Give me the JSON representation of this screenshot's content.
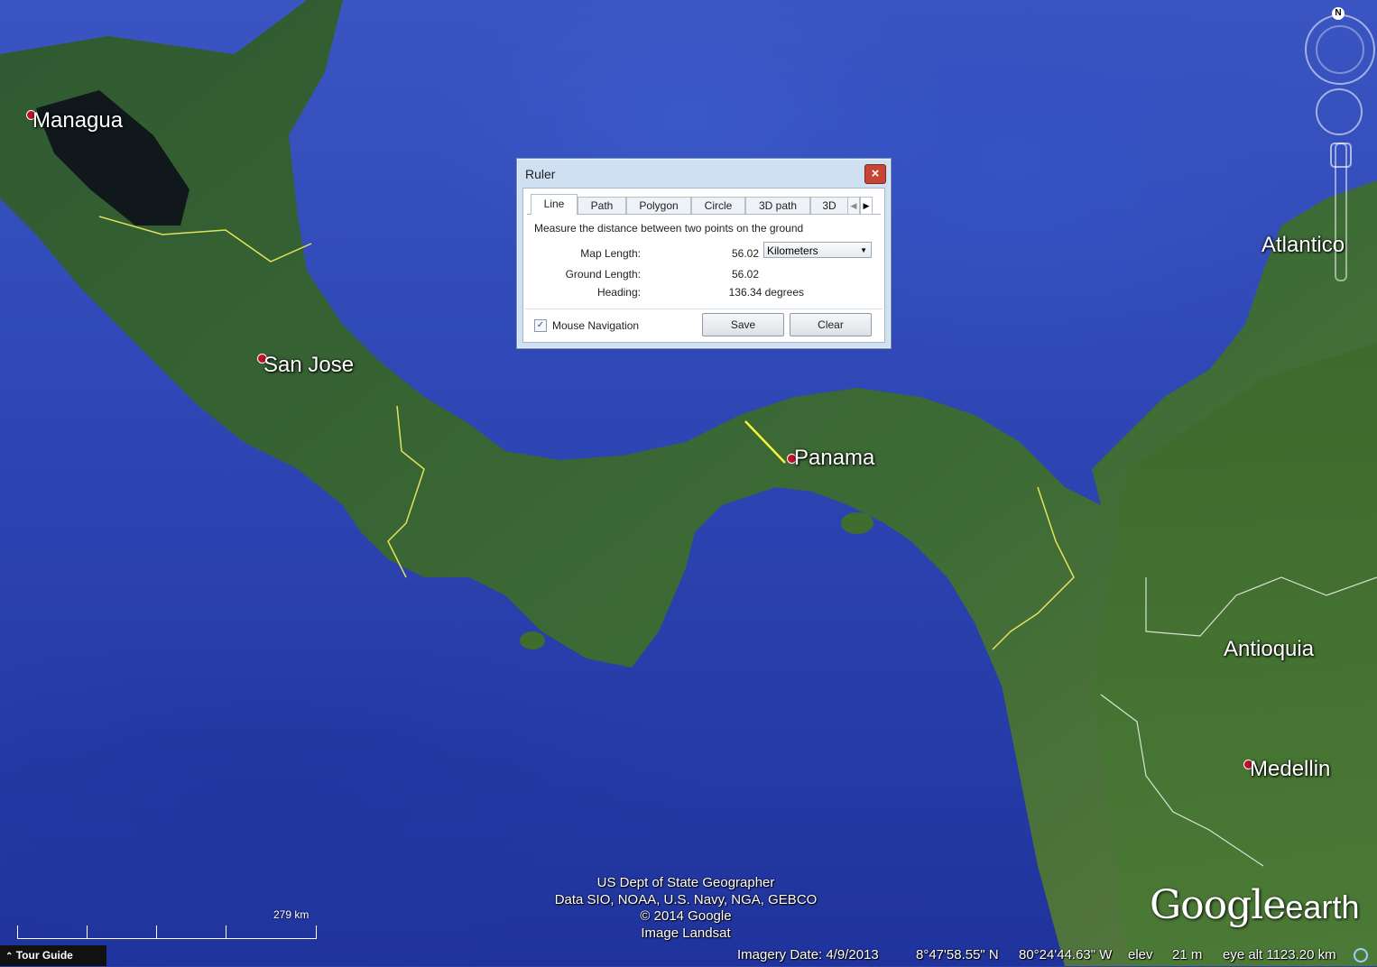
{
  "map": {
    "places": [
      {
        "name": "Managua"
      },
      {
        "name": "San Jose"
      },
      {
        "name": "Panama"
      },
      {
        "name": "Atlantico"
      },
      {
        "name": "Antioquia"
      },
      {
        "name": "Medellin"
      }
    ],
    "north_label": "N",
    "scale_label": "279 km",
    "credits": [
      "US Dept of State Geographer",
      "Data SIO, NOAA, U.S. Navy, NGA, GEBCO",
      "© 2014 Google",
      "Image Landsat"
    ],
    "logo": {
      "google": "Google",
      "earth": "earth"
    }
  },
  "ruler": {
    "title": "Ruler",
    "close_label": "×",
    "tabs": [
      "Line",
      "Path",
      "Polygon",
      "Circle",
      "3D path",
      "3D"
    ],
    "active_tab": "Line",
    "description": "Measure the distance between two points on the ground",
    "map_length_label": "Map Length:",
    "map_length_value": "56.02",
    "unit": "Kilometers",
    "ground_length_label": "Ground Length:",
    "ground_length_value": "56.02",
    "heading_label": "Heading:",
    "heading_value": "136.34 degrees",
    "mouse_navigation_label": "Mouse Navigation",
    "mouse_navigation_checked": true,
    "save_label": "Save",
    "clear_label": "Clear"
  },
  "statusbar": {
    "tour_guide": "Tour Guide",
    "imagery_date": "Imagery Date: 4/9/2013",
    "lat": "8°47'58.55\" N",
    "lon": "80°24'44.63\" W",
    "elev_label": "elev",
    "elev_value": "21 m",
    "eye_alt": "eye alt 1123.20 km"
  }
}
